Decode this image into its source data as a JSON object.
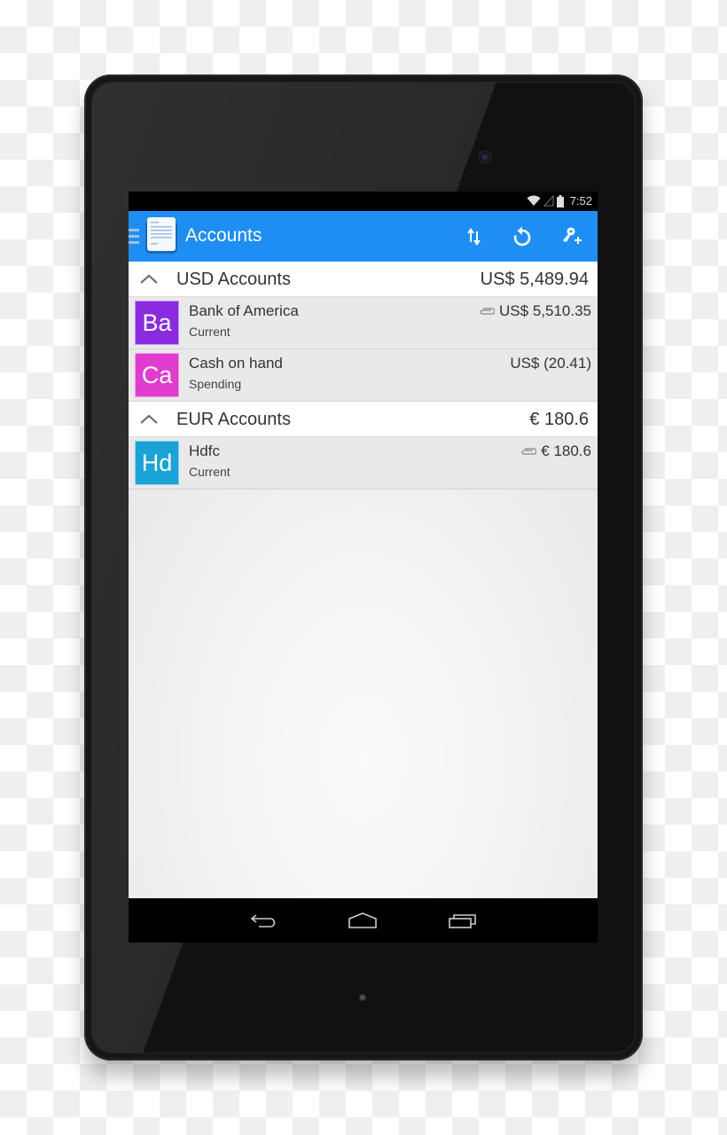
{
  "status_bar": {
    "time": "7:52",
    "icons": [
      "wifi-icon",
      "cell-signal-icon",
      "battery-icon"
    ]
  },
  "action_bar": {
    "title": "Accounts",
    "logo_icon": "document-icon",
    "drawer_icon": "hamburger-icon",
    "actions": [
      {
        "name": "sort",
        "icon": "sort-arrows-icon"
      },
      {
        "name": "refresh",
        "icon": "refresh-icon"
      },
      {
        "name": "add-account",
        "icon": "key-plus-icon"
      }
    ]
  },
  "groups": [
    {
      "title": "USD Accounts",
      "total": "US$ 5,489.94",
      "expanded": true,
      "accounts": [
        {
          "initials": "Ba",
          "name": "Bank of America",
          "type": "Current",
          "amount": "US$ 5,510.35",
          "color": "#8a2be2",
          "has_clip": true
        },
        {
          "initials": "Ca",
          "name": "Cash on hand",
          "type": "Spending",
          "amount": "US$ (20.41)",
          "color": "#e03ccf",
          "has_clip": false
        }
      ]
    },
    {
      "title": "EUR Accounts",
      "total": "€ 180.6",
      "expanded": true,
      "accounts": [
        {
          "initials": "Hd",
          "name": "Hdfc",
          "type": "Current",
          "amount": "€ 180.6",
          "color": "#1aa3d6",
          "has_clip": true
        }
      ]
    }
  ],
  "nav_bar": {
    "buttons": [
      "back",
      "home",
      "recents"
    ]
  },
  "colors": {
    "action_bar": "#1e8ef5",
    "row_bg": "#e9e9e9",
    "header_bg": "#ffffff"
  }
}
